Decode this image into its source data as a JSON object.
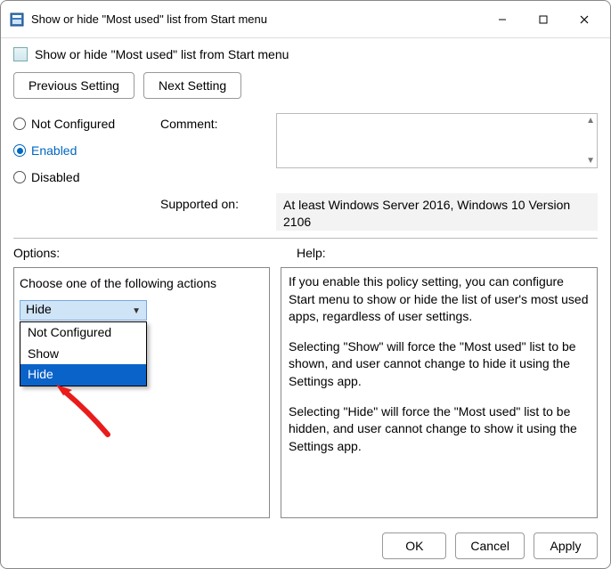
{
  "window": {
    "title": "Show or hide \"Most used\" list from Start menu"
  },
  "header": {
    "page_title": "Show or hide \"Most used\" list from Start menu"
  },
  "nav": {
    "prev": "Previous Setting",
    "next": "Next Setting"
  },
  "state_radios": {
    "not_configured": "Not Configured",
    "enabled": "Enabled",
    "disabled": "Disabled",
    "selected": "enabled"
  },
  "labels": {
    "comment": "Comment:",
    "supported": "Supported on:",
    "options": "Options:",
    "help": "Help:"
  },
  "supported_on": "At least Windows Server 2016, Windows 10 Version 2106",
  "options": {
    "prompt": "Choose one of the following actions",
    "selected": "Hide",
    "items": [
      "Not Configured",
      "Show",
      "Hide"
    ],
    "highlight_index": 2
  },
  "help": {
    "p1": "If you enable this policy setting, you can configure Start menu to show or hide the list of user's most used apps, regardless of user settings.",
    "p2": "Selecting \"Show\" will force the \"Most used\" list to be shown, and user cannot change to hide it using the Settings app.",
    "p3": "Selecting \"Hide\" will force the \"Most used\" list to be hidden, and user cannot change to show it using the Settings app."
  },
  "footer": {
    "ok": "OK",
    "cancel": "Cancel",
    "apply": "Apply"
  }
}
